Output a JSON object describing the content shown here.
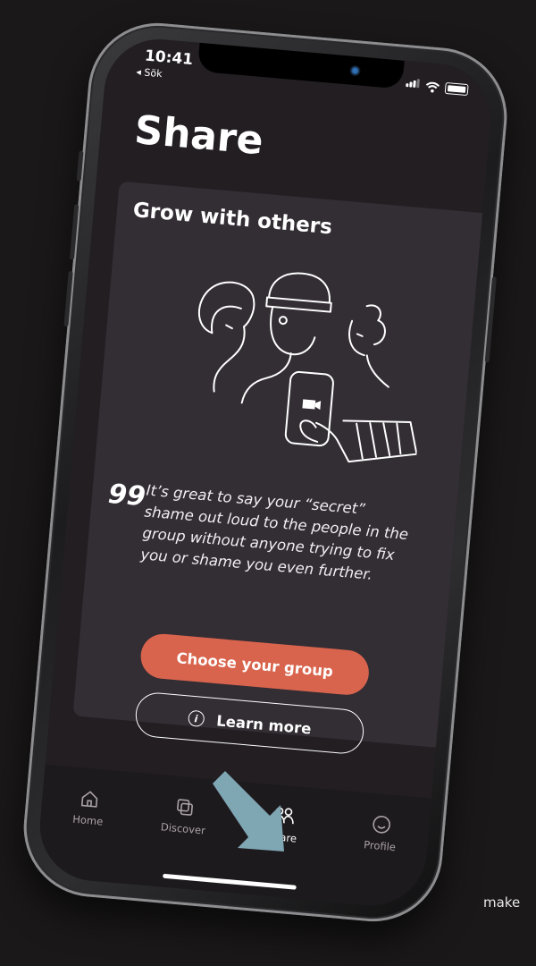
{
  "status": {
    "time": "10:41",
    "back_label": "◂ Sök"
  },
  "page": {
    "title": "Share"
  },
  "card": {
    "title": "Grow with others",
    "quote_mark": "99",
    "quote": "It’s great to say your “secret” shame out loud to the people in the group without anyone trying to fix you or shame you even further.",
    "primary_button": "Choose your group",
    "secondary_button": "Learn more"
  },
  "tabs": [
    {
      "label": "Home",
      "icon": "home-icon"
    },
    {
      "label": "Discover",
      "icon": "discover-icon"
    },
    {
      "label": "Share",
      "icon": "share-icon",
      "active": true
    },
    {
      "label": "Profile",
      "icon": "profile-icon"
    }
  ],
  "side_text": "make",
  "colors": {
    "accent": "#d9644d",
    "card": "#332d34",
    "screen": "#221e22",
    "arrow": "#7fa6b3"
  }
}
